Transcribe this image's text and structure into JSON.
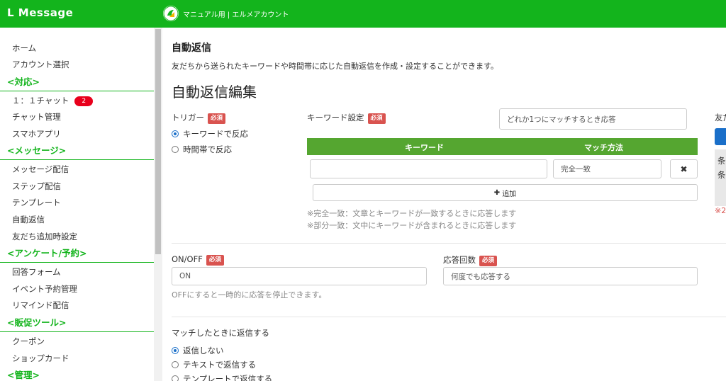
{
  "app": {
    "brand": "L Message",
    "account_name": "マニュアル用 | エルメアカウント"
  },
  "sidebar": {
    "items": [
      {
        "type": "item",
        "label": "ホーム"
      },
      {
        "type": "item",
        "label": "アカウント選択"
      },
      {
        "type": "head",
        "label": "<対応>"
      },
      {
        "type": "item",
        "label": "１：１チャット",
        "badge": "2"
      },
      {
        "type": "item",
        "label": "チャット管理"
      },
      {
        "type": "item",
        "label": "スマホアプリ"
      },
      {
        "type": "head",
        "label": "<メッセージ>"
      },
      {
        "type": "item",
        "label": "メッセージ配信"
      },
      {
        "type": "item",
        "label": "ステップ配信"
      },
      {
        "type": "item",
        "label": "テンプレート"
      },
      {
        "type": "item",
        "label": "自動返信"
      },
      {
        "type": "item",
        "label": "友だち追加時設定"
      },
      {
        "type": "head",
        "label": "<アンケート/予約>"
      },
      {
        "type": "item",
        "label": "回答フォーム"
      },
      {
        "type": "item",
        "label": "イベント予約管理"
      },
      {
        "type": "item",
        "label": "リマインド配信"
      },
      {
        "type": "head",
        "label": "<販促ツール>"
      },
      {
        "type": "item",
        "label": "クーポン"
      },
      {
        "type": "item",
        "label": "ショップカード"
      },
      {
        "type": "head",
        "label": "<管理>"
      }
    ]
  },
  "main": {
    "page_title": "自動返信",
    "description": "友だちから送られたキーワードや時間帯に応じた自動返信を作成・設定することができます。",
    "section_title": "自動返信編集",
    "required_label": "必須",
    "trigger": {
      "label": "トリガー",
      "options": [
        {
          "label": "キーワードで反応",
          "checked": true
        },
        {
          "label": "時間帯で反応",
          "checked": false
        }
      ]
    },
    "keyword": {
      "label": "キーワード設定",
      "match_mode_value": "どれか1つにマッチするとき応答",
      "col_keyword": "キーワード",
      "col_match": "マッチ方法",
      "row_keyword_value": "",
      "row_match_value": "完全一致",
      "delete_glyph": "✖",
      "add_label": "追加",
      "add_glyph": "✚",
      "note1": "※完全一致：文章とキーワードが一致するときに応答します",
      "note2": "※部分一致：文中にキーワードが含まれるときに応答します"
    },
    "right_panel": {
      "label_fragment": "友だ",
      "line1": "条",
      "line2": "条",
      "note_fragment": "※2"
    },
    "onoff": {
      "label": "ON/OFF",
      "value": "ON",
      "help": "OFFにすると一時的に応答を停止できます。"
    },
    "response_count": {
      "label": "応答回数",
      "value": "何度でも応答する"
    },
    "reply": {
      "label": "マッチしたときに返信する",
      "options": [
        {
          "label": "返信しない",
          "checked": true
        },
        {
          "label": "テキストで返信する",
          "checked": false
        },
        {
          "label": "テンプレートで返信する",
          "checked": false
        }
      ]
    }
  },
  "colors": {
    "brand_green": "#13b41c",
    "table_header_green": "#55a630",
    "required_red": "#d9534f",
    "badge_red": "#e8001c"
  }
}
